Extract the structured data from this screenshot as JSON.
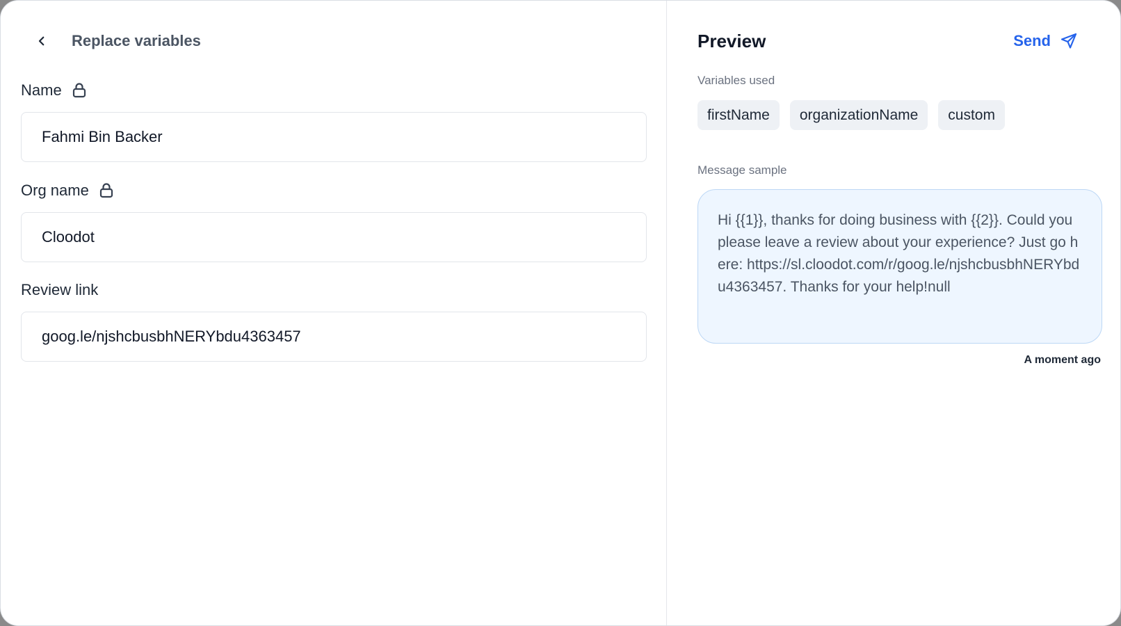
{
  "left": {
    "title": "Replace variables",
    "fields": [
      {
        "label": "Name",
        "value": "Fahmi Bin Backer",
        "locked": true
      },
      {
        "label": "Org name",
        "value": "Cloodot",
        "locked": true
      },
      {
        "label": "Review link",
        "value": "goog.le/njshcbusbhNERYbdu4363457",
        "locked": false
      }
    ]
  },
  "preview": {
    "title": "Preview",
    "send_label": "Send",
    "variables_label": "Variables used",
    "variables": [
      "firstName",
      "organizationName",
      "custom"
    ],
    "message_label": "Message sample",
    "message": "Hi {{1}}, thanks for doing business with {{2}}. Could you please leave a review about your experience? Just go here: https://sl.cloodot.com/r/goog.le/njshcbusbhNERYbdu4363457. Thanks for your help!null",
    "timestamp": "A moment ago"
  },
  "colors": {
    "accent": "#2563eb",
    "bubble_bg": "#eef6ff",
    "chip_bg": "#eef1f5"
  },
  "icons": {
    "back": "chevron-left-icon",
    "lock": "lock-icon",
    "send": "paper-plane-icon"
  }
}
